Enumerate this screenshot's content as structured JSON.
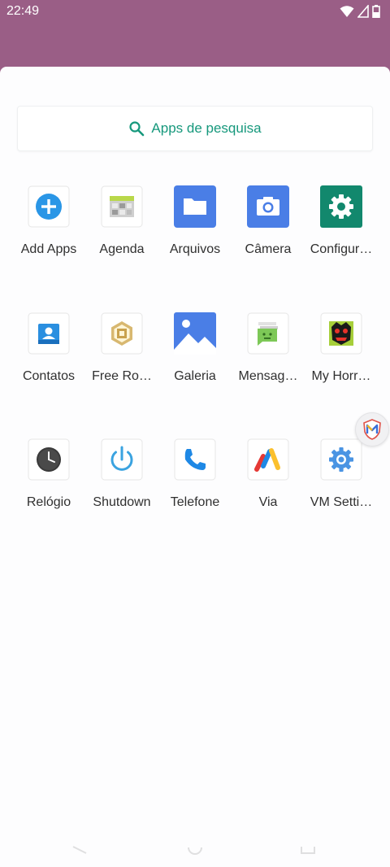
{
  "status_bar": {
    "time": "22:49",
    "icons": [
      "wifi-icon",
      "signal-icon",
      "battery-icon"
    ]
  },
  "search": {
    "label": "Apps de pesquisa",
    "icon": "search-icon",
    "color": "#16987c"
  },
  "apps": [
    {
      "label": "Add Apps",
      "icon": "add-apps-icon"
    },
    {
      "label": "Agenda",
      "icon": "agenda-icon"
    },
    {
      "label": "Arquivos",
      "icon": "files-icon"
    },
    {
      "label": "Câmera",
      "icon": "camera-icon"
    },
    {
      "label": "Configur…",
      "icon": "settings-icon"
    },
    {
      "label": "Contatos",
      "icon": "contacts-icon"
    },
    {
      "label": "Free Ro…",
      "icon": "free-robux-icon"
    },
    {
      "label": "Galeria",
      "icon": "gallery-icon"
    },
    {
      "label": "Mensag…",
      "icon": "messages-icon"
    },
    {
      "label": "My Horr…",
      "icon": "my-horror-icon"
    },
    {
      "label": "Relógio",
      "icon": "clock-icon"
    },
    {
      "label": "Shutdown",
      "icon": "power-icon"
    },
    {
      "label": "Telefone",
      "icon": "phone-icon"
    },
    {
      "label": "Via",
      "icon": "via-icon"
    },
    {
      "label": "VM Setti…",
      "icon": "vm-settings-gear-icon"
    }
  ],
  "colors": {
    "wallpaper": "#9a5e86",
    "drawer": "#fdfdfe",
    "label": "#303030"
  }
}
